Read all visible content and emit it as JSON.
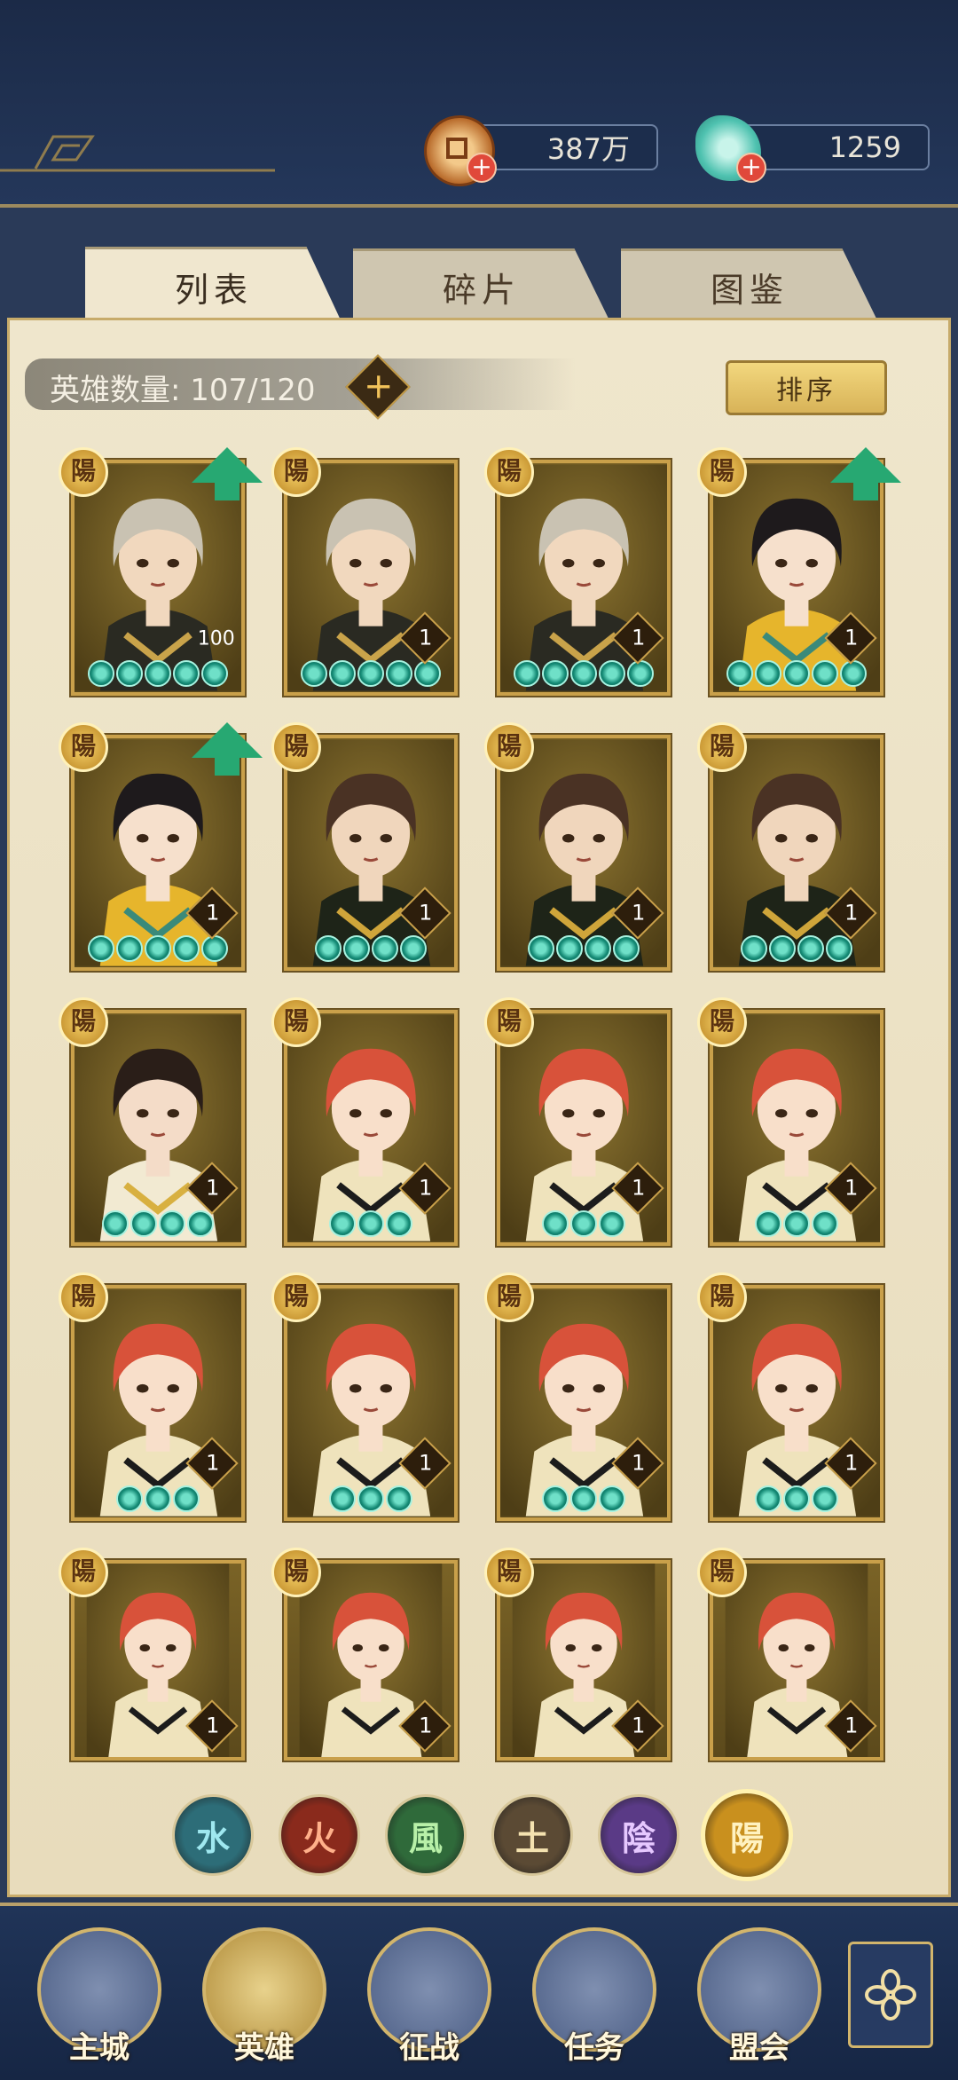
{
  "header": {
    "currencies": [
      {
        "icon": "copper-coin-icon",
        "value": "387万"
      },
      {
        "icon": "jade-gem-icon",
        "value": "1259"
      }
    ]
  },
  "tabs": [
    {
      "label": "列表",
      "active": true
    },
    {
      "label": "碎片",
      "active": false
    },
    {
      "label": "图鉴",
      "active": false
    }
  ],
  "hero_count": {
    "label": "英雄数量: 107/120"
  },
  "sort_button": {
    "label": "排序"
  },
  "badge_text": "陽",
  "heroes": [
    {
      "type": "silver-hair-male",
      "level": "100",
      "stars": 5,
      "upgrade": true
    },
    {
      "type": "silver-hair-male",
      "level": "1",
      "stars": 5,
      "upgrade": false
    },
    {
      "type": "silver-hair-male",
      "level": "1",
      "stars": 5,
      "upgrade": false
    },
    {
      "type": "fan-lady",
      "level": "1",
      "stars": 5,
      "upgrade": true
    },
    {
      "type": "fan-lady",
      "level": "1",
      "stars": 5,
      "upgrade": true
    },
    {
      "type": "dark-robe-male",
      "level": "1",
      "stars": 4,
      "upgrade": false
    },
    {
      "type": "dark-robe-male",
      "level": "1",
      "stars": 4,
      "upgrade": false
    },
    {
      "type": "dark-robe-male",
      "level": "1",
      "stars": 4,
      "upgrade": false
    },
    {
      "type": "black-hair-lady",
      "level": "1",
      "stars": 4,
      "upgrade": false
    },
    {
      "type": "red-hair-girl",
      "level": "1",
      "stars": 3,
      "upgrade": false
    },
    {
      "type": "red-hair-girl",
      "level": "1",
      "stars": 3,
      "upgrade": false
    },
    {
      "type": "red-hair-girl",
      "level": "1",
      "stars": 3,
      "upgrade": false
    },
    {
      "type": "red-hair-girl",
      "level": "1",
      "stars": 3,
      "upgrade": false
    },
    {
      "type": "red-hair-girl",
      "level": "1",
      "stars": 3,
      "upgrade": false
    },
    {
      "type": "red-hair-girl",
      "level": "1",
      "stars": 3,
      "upgrade": false
    },
    {
      "type": "red-hair-girl",
      "level": "1",
      "stars": 3,
      "upgrade": false
    },
    {
      "type": "red-hair-girl",
      "level": "1",
      "stars": 0,
      "upgrade": false
    },
    {
      "type": "red-hair-girl",
      "level": "1",
      "stars": 0,
      "upgrade": false
    },
    {
      "type": "red-hair-girl",
      "level": "1",
      "stars": 0,
      "upgrade": false
    },
    {
      "type": "red-hair-girl",
      "level": "1",
      "stars": 0,
      "upgrade": false
    }
  ],
  "element_filters": [
    {
      "glyph": "水",
      "color": "#2d6d78",
      "text_color": "#9fe8f0",
      "active": false
    },
    {
      "glyph": "火",
      "color": "#8a2a1c",
      "text_color": "#ffb08a",
      "active": false
    },
    {
      "glyph": "風",
      "color": "#2f6a3a",
      "text_color": "#b8f0a8",
      "active": false
    },
    {
      "glyph": "土",
      "color": "#5b4a34",
      "text_color": "#f4e2b0",
      "active": false
    },
    {
      "glyph": "陰",
      "color": "#5a3a86",
      "text_color": "#e6c8ff",
      "active": false
    },
    {
      "glyph": "陽",
      "color": "#c9901e",
      "text_color": "#fff2c0",
      "active": true
    }
  ],
  "bottom_nav": [
    {
      "label": "主城",
      "icon": "city-gate-icon",
      "active": false
    },
    {
      "label": "英雄",
      "icon": "hero-portrait-icon",
      "active": true
    },
    {
      "label": "征战",
      "icon": "campaign-icon",
      "active": false
    },
    {
      "label": "任务",
      "icon": "task-scroll-icon",
      "active": false
    },
    {
      "label": "盟会",
      "icon": "alliance-pavilion-icon",
      "active": false
    }
  ],
  "menu_icon": "flower-menu-icon"
}
